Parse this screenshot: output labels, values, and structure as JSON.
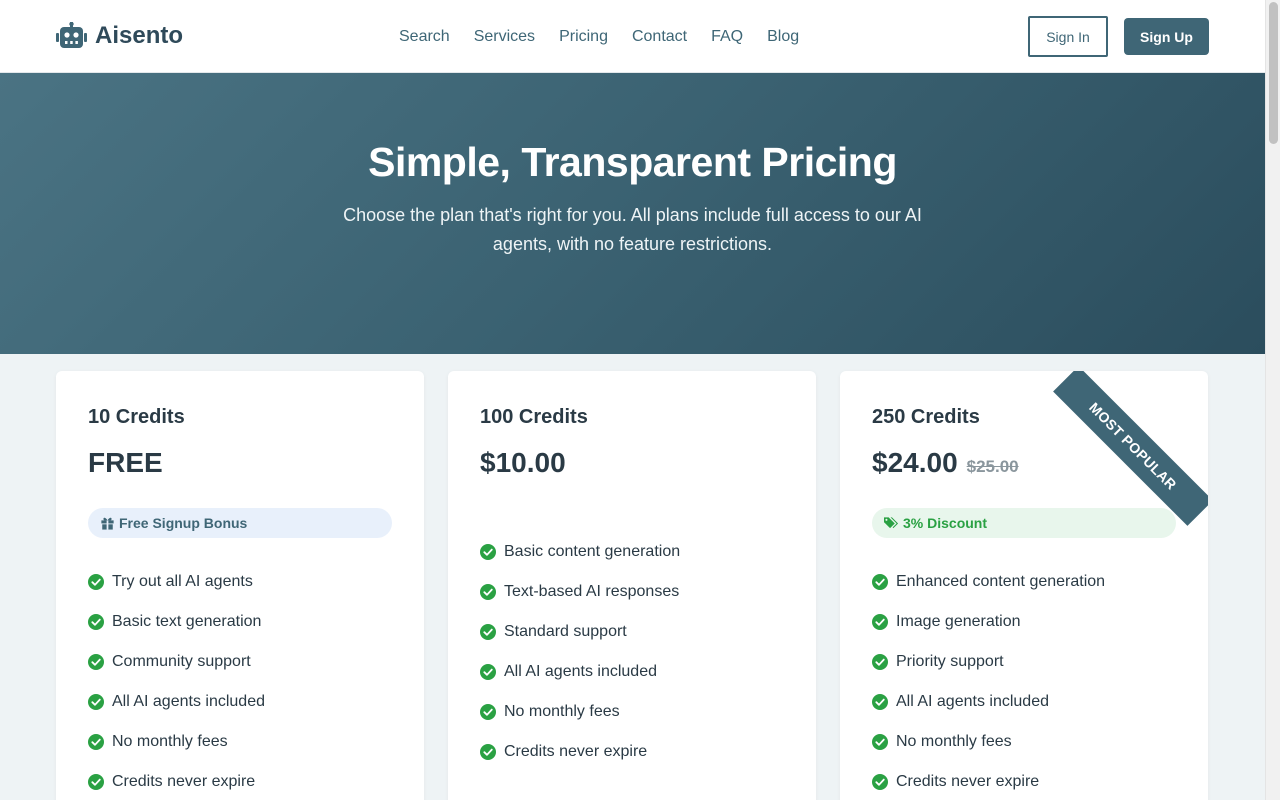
{
  "brand": {
    "name": "Aisento",
    "logo_icon": "robot-icon"
  },
  "nav": [
    {
      "label": "Search"
    },
    {
      "label": "Services"
    },
    {
      "label": "Pricing"
    },
    {
      "label": "Contact"
    },
    {
      "label": "FAQ"
    },
    {
      "label": "Blog"
    }
  ],
  "auth": {
    "sign_in": "Sign In",
    "sign_up": "Sign Up"
  },
  "hero": {
    "title": "Simple, Transparent Pricing",
    "subtitle": "Choose the plan that's right for you. All plans include full access to our AI agents, with no feature restrictions."
  },
  "plans": [
    {
      "title": "10 Credits",
      "price": "FREE",
      "badge": "Free Signup Bonus",
      "badge_icon": "gift-icon",
      "features": [
        "Try out all AI agents",
        "Basic text generation",
        "Community support",
        "All AI agents included",
        "No monthly fees",
        "Credits never expire"
      ]
    },
    {
      "title": "100 Credits",
      "price": "$10.00",
      "features": [
        "Basic content generation",
        "Text-based AI responses",
        "Standard support",
        "All AI agents included",
        "No monthly fees",
        "Credits never expire"
      ]
    },
    {
      "title": "250 Credits",
      "price": "$24.00",
      "old_price": "$25.00",
      "ribbon": "MOST POPULAR",
      "badge": "3% Discount",
      "badge_icon": "tags-icon",
      "features": [
        "Enhanced content generation",
        "Image generation",
        "Priority support",
        "All AI agents included",
        "No monthly fees",
        "Credits never expire"
      ]
    }
  ],
  "colors": {
    "primary": "#3f6676",
    "success": "#2aa143",
    "hero_from": "#4a7383",
    "hero_to": "#2b4d5d"
  }
}
